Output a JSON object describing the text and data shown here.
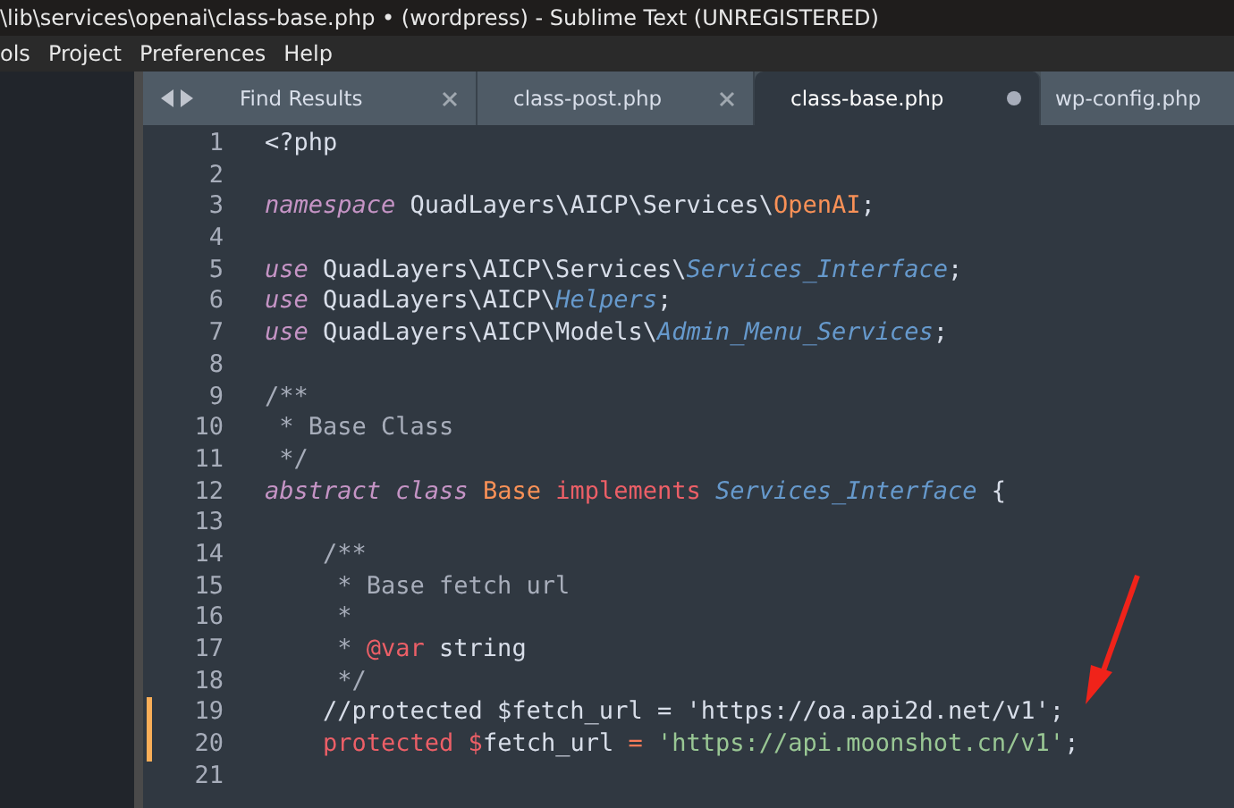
{
  "window": {
    "title": "\\lib\\services\\openai\\class-base.php • (wordpress) - Sublime Text (UNREGISTERED)"
  },
  "menu": [
    "ols",
    "Project",
    "Preferences",
    "Help"
  ],
  "tabs": [
    {
      "label": "Find Results",
      "selected": false,
      "dirty": false
    },
    {
      "label": "class-post.php",
      "selected": false,
      "dirty": false
    },
    {
      "label": "class-base.php",
      "selected": true,
      "dirty": true
    },
    {
      "label": "wp-config.php",
      "selected": false
    }
  ],
  "editor": {
    "lines": [
      {
        "number": "1",
        "modified": false,
        "tokens": [
          {
            "kind": "plain",
            "text": "<?php"
          }
        ]
      },
      {
        "number": "2",
        "modified": false
      },
      {
        "number": "3",
        "modified": false,
        "tokens": [
          {
            "kind": "keyword",
            "text": "namespace"
          },
          {
            "kind": "plain",
            "text": " QuadLayers\\AICP\\Services\\"
          },
          {
            "kind": "entity",
            "text": "OpenAI"
          },
          {
            "kind": "plain",
            "text": ";"
          }
        ]
      },
      {
        "number": "4",
        "modified": false
      },
      {
        "number": "5",
        "modified": false,
        "tokens": [
          {
            "kind": "keyword",
            "text": "use"
          },
          {
            "kind": "plain",
            "text": " QuadLayers\\AICP\\Services\\"
          },
          {
            "kind": "type",
            "text": "Services_Interface"
          },
          {
            "kind": "plain",
            "text": ";"
          }
        ]
      },
      {
        "number": "6",
        "modified": false,
        "tokens": [
          {
            "kind": "keyword",
            "text": "use"
          },
          {
            "kind": "plain",
            "text": " QuadLayers\\AICP\\"
          },
          {
            "kind": "type",
            "text": "Helpers"
          },
          {
            "kind": "plain",
            "text": ";"
          }
        ]
      },
      {
        "number": "7",
        "modified": false,
        "tokens": [
          {
            "kind": "keyword",
            "text": "use"
          },
          {
            "kind": "plain",
            "text": " QuadLayers\\AICP\\Models\\"
          },
          {
            "kind": "type",
            "text": "Admin_Menu_Services"
          },
          {
            "kind": "plain",
            "text": ";"
          }
        ]
      },
      {
        "number": "8",
        "modified": false
      },
      {
        "number": "9",
        "modified": false,
        "tokens": [
          {
            "kind": "comment",
            "text": "/**"
          }
        ]
      },
      {
        "number": "10",
        "modified": false,
        "tokens": [
          {
            "kind": "comment",
            "text": " * Base Class"
          }
        ]
      },
      {
        "number": "11",
        "modified": false,
        "tokens": [
          {
            "kind": "comment",
            "text": " */"
          }
        ]
      },
      {
        "number": "12",
        "modified": false,
        "tokens": [
          {
            "kind": "keyword",
            "text": "abstract"
          },
          {
            "kind": "keyword",
            "text": " class"
          },
          {
            "kind": "entity",
            "text": " Base"
          },
          {
            "kind": "storage",
            "text": " implements"
          },
          {
            "kind": "type",
            "text": " Services_Interface"
          },
          {
            "kind": "plain",
            "text": " {"
          }
        ]
      },
      {
        "number": "13",
        "modified": false
      },
      {
        "number": "14",
        "modified": false,
        "tokens": [
          {
            "kind": "comment",
            "text": "    /**"
          }
        ]
      },
      {
        "number": "15",
        "modified": false,
        "tokens": [
          {
            "kind": "comment",
            "text": "     * Base fetch url"
          }
        ]
      },
      {
        "number": "16",
        "modified": false,
        "tokens": [
          {
            "kind": "comment",
            "text": "     *"
          }
        ]
      },
      {
        "number": "17",
        "modified": false,
        "tokens": [
          {
            "kind": "comment",
            "text": "     * "
          },
          {
            "kind": "storage",
            "text": "@var"
          },
          {
            "kind": "plain",
            "text": " string"
          }
        ]
      },
      {
        "number": "18",
        "modified": false,
        "tokens": [
          {
            "kind": "comment",
            "text": "     */"
          }
        ]
      },
      {
        "number": "19",
        "modified": true,
        "tokens": [
          {
            "kind": "plain",
            "text": "    //protected $fetch_url = 'https://oa.api2d.net/v1';"
          }
        ]
      },
      {
        "number": "20",
        "modified": true,
        "tokens": [
          {
            "kind": "storage",
            "text": "    protected"
          },
          {
            "kind": "storage",
            "text": " $"
          },
          {
            "kind": "plain",
            "text": "fetch_url "
          },
          {
            "kind": "operator",
            "text": "="
          },
          {
            "kind": "string",
            "text": " 'https://api.moonshot.cn/v1'"
          },
          {
            "kind": "plain",
            "text": ";"
          }
        ]
      },
      {
        "number": "21",
        "modified": false
      }
    ]
  }
}
